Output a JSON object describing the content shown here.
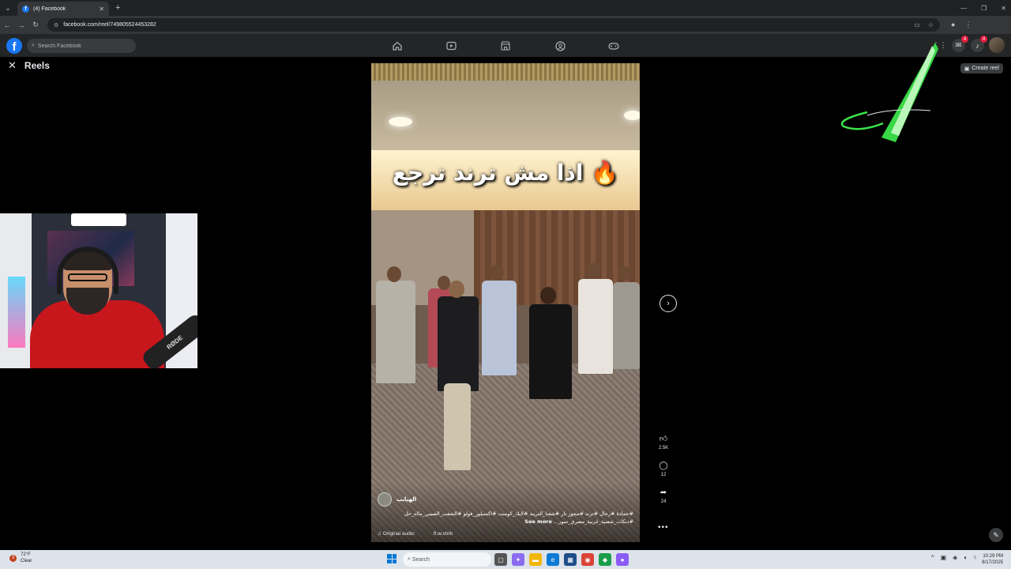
{
  "browser": {
    "tab_title": "(4) Facebook",
    "tab_favicon": "f",
    "url": "facebook.com/reel/749805524453282"
  },
  "facebook": {
    "logo_letter": "f",
    "search_placeholder": "Search Facebook",
    "notification_badge": "4",
    "messenger_badge": "4"
  },
  "reels": {
    "title": "Reels",
    "create_label": "Create reel"
  },
  "video": {
    "overlay_text": "اذا مش ترند ترجع",
    "author": "الهيايب",
    "caption": "#حمادة #رحال #ترند #مجوز نار #شعنا_التريند #لايك_كومنت #اكسبلور_فولو #الشعب_الصيني_ماله_حل #دبكات_شعبية_غربية_مصري_سور...",
    "see_more": "See more",
    "audio": "Original audio",
    "audio_source": "ft.w.shrb"
  },
  "actions": {
    "likes": "2.5K",
    "comments": "12",
    "shares": "24"
  },
  "webcam": {
    "mic_brand": "RØDE"
  },
  "taskbar": {
    "temp": "72°F",
    "weather": "Clear",
    "weather_badge": "3",
    "search_placeholder": "Search",
    "time": "10:29 PM",
    "date": "8/17/2025"
  },
  "colors": {
    "fb_blue": "#1877f2",
    "badge_red": "#e41e3f",
    "bar_bg": "#242526"
  }
}
